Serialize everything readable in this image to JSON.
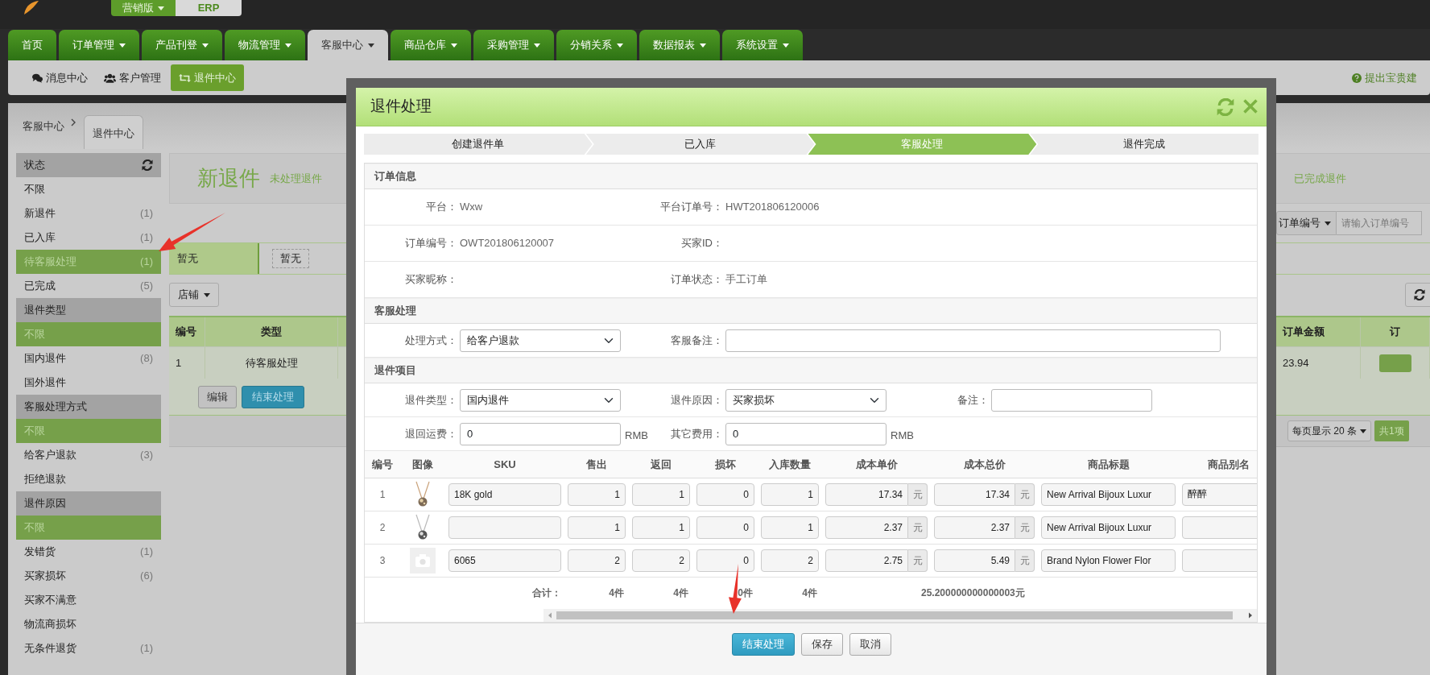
{
  "top_bar": {
    "edition_menu": "营销版",
    "product": "ERP"
  },
  "main_nav": [
    {
      "label": "首页",
      "dropdown": false,
      "selected": false
    },
    {
      "label": "订单管理",
      "dropdown": true,
      "selected": false
    },
    {
      "label": "产品刊登",
      "dropdown": true,
      "selected": false
    },
    {
      "label": "物流管理",
      "dropdown": true,
      "selected": false
    },
    {
      "label": "客服中心",
      "dropdown": true,
      "selected": true
    },
    {
      "label": "商品仓库",
      "dropdown": true,
      "selected": false
    },
    {
      "label": "采购管理",
      "dropdown": true,
      "selected": false
    },
    {
      "label": "分销关系",
      "dropdown": true,
      "selected": false
    },
    {
      "label": "数据报表",
      "dropdown": true,
      "selected": false
    },
    {
      "label": "系统设置",
      "dropdown": true,
      "selected": false
    }
  ],
  "sub_nav": [
    {
      "label": "消息中心",
      "kind": "messages",
      "selected": false
    },
    {
      "label": "客户管理",
      "kind": "customers",
      "selected": false
    },
    {
      "label": "退件中心",
      "kind": "returns",
      "selected": true
    }
  ],
  "help_link": "提出宝贵建",
  "breadcrumb": {
    "root": "客服中心",
    "tab": "退件中心"
  },
  "sidebar": [
    {
      "title": "状态",
      "refresh": true,
      "items": [
        {
          "label": "不限",
          "selected": false
        },
        {
          "label": "新退件",
          "count": "(1)",
          "selected": false
        },
        {
          "label": "已入库",
          "count": "(1)",
          "selected": false
        },
        {
          "label": "待客服处理",
          "count": "(1)",
          "selected": true
        },
        {
          "label": "已完成",
          "count": "(5)",
          "selected": false
        }
      ]
    },
    {
      "title": "退件类型",
      "refresh": false,
      "items": [
        {
          "label": "不限",
          "selected": true
        },
        {
          "label": "国内退件",
          "count": "(8)",
          "selected": false
        },
        {
          "label": "国外退件",
          "selected": false
        }
      ]
    },
    {
      "title": "客服处理方式",
      "refresh": false,
      "items": [
        {
          "label": "不限",
          "selected": true
        },
        {
          "label": "给客户退款",
          "count": "(3)",
          "selected": false
        },
        {
          "label": "拒绝退款",
          "selected": false
        }
      ]
    },
    {
      "title": "退件原因",
      "refresh": false,
      "items": [
        {
          "label": "不限",
          "selected": true
        },
        {
          "label": "发错货",
          "count": "(1)",
          "selected": false
        },
        {
          "label": "买家损坏",
          "count": "(6)",
          "selected": false
        },
        {
          "label": "买家不满意",
          "selected": false
        },
        {
          "label": "物流商损坏",
          "selected": false
        },
        {
          "label": "无条件退货",
          "count": "(1)",
          "selected": false
        }
      ]
    }
  ],
  "summary": {
    "title": "新退件",
    "subtitle": "未处理退件",
    "right_label": "已完成退件"
  },
  "search": {
    "field": "订单编号",
    "placeholder": "请输入订单编号"
  },
  "filter_tabs": [
    {
      "label": "暂无",
      "selected": true
    },
    {
      "label": "暂无",
      "selected": false
    }
  ],
  "shop_button": "店铺",
  "list_table": {
    "columns_left": [
      "编号",
      "类型"
    ],
    "columns_right": [
      "订单金额",
      "订"
    ],
    "rows": [
      {
        "no": "1",
        "type": "待客服处理",
        "amount": "23.94"
      }
    ],
    "actions": [
      {
        "label": "编辑",
        "kind": "default"
      },
      {
        "label": "结束处理",
        "kind": "primary"
      }
    ]
  },
  "pagination": {
    "page_size": "每页显示 20 条",
    "total": "共1项"
  },
  "modal": {
    "title": "退件处理",
    "steps": [
      {
        "label": "创建退件单",
        "selected": false
      },
      {
        "label": "已入库",
        "selected": false
      },
      {
        "label": "客服处理",
        "selected": true
      },
      {
        "label": "退件完成",
        "selected": false
      }
    ],
    "sections": [
      {
        "title": "订单信息",
        "kind": "info",
        "rows": [
          [
            {
              "label": "平台：",
              "value": "Wxw"
            },
            {
              "label": "平台订单号：",
              "value": "HWT201806120006"
            }
          ],
          [
            {
              "label": "订单编号：",
              "value": "OWT201806120007"
            },
            {
              "label": "买家ID："
            }
          ],
          [
            {
              "label": "买家昵称："
            },
            {
              "label": "订单状态：",
              "value": "手工订单"
            }
          ]
        ]
      },
      {
        "title": "客服处理",
        "kind": "form",
        "rows": [
          [
            {
              "kind": "select",
              "label": "处理方式：",
              "value": "给客户退款"
            },
            {
              "kind": "input",
              "label": "客服备注："
            }
          ]
        ]
      },
      {
        "title": "退件项目",
        "kind": "form",
        "rows": [
          [
            {
              "kind": "select",
              "label": "退件类型：",
              "value": "国内退件"
            },
            {
              "kind": "select",
              "label": "退件原因：",
              "value": "买家损坏"
            },
            {
              "kind": "input",
              "label": "备注："
            }
          ],
          [
            {
              "kind": "input",
              "label": "退回运费：",
              "value": "0",
              "unit": "RMB"
            },
            {
              "kind": "input",
              "label": "其它费用：",
              "value": "0",
              "unit": "RMB"
            }
          ]
        ]
      }
    ],
    "items_table": {
      "columns": [
        "编号",
        "图像",
        "SKU",
        "售出",
        "返回",
        "损坏",
        "入库数量",
        "成本单价",
        "成本总价",
        "商品标题",
        "商品别名"
      ],
      "rows": [
        {
          "no": "1",
          "sku": "18K gold",
          "sold": "1",
          "returned": "1",
          "damaged": "0",
          "stocked": "1",
          "unit_cost": "17.34",
          "unit_cost_currency": "元",
          "total_cost": "17.34",
          "total_cost_currency": "元",
          "title": "New Arrival Bijoux Luxur",
          "alias": "醉醉"
        },
        {
          "no": "2",
          "sold": "1",
          "returned": "1",
          "damaged": "0",
          "stocked": "1",
          "unit_cost": "2.37",
          "unit_cost_currency": "元",
          "total_cost": "2.37",
          "total_cost_currency": "元",
          "title": "New Arrival Bijoux Luxur"
        },
        {
          "no": "3",
          "image": {
            "kind": "placeholder"
          },
          "sku": "6065",
          "sold": "2",
          "returned": "2",
          "damaged": "0",
          "stocked": "2",
          "unit_cost": "2.75",
          "unit_cost_currency": "元",
          "total_cost": "5.49",
          "total_cost_currency": "元",
          "title": "Brand Nylon Flower Flor"
        }
      ],
      "totals": {
        "label": "合计：",
        "sold": "4件",
        "returned": "4件",
        "damaged": "0件",
        "stocked": "4件",
        "total_cost": "25.200000000000003元"
      }
    },
    "buttons": [
      {
        "label": "结束处理",
        "kind": "primary"
      },
      {
        "label": "保存",
        "kind": "default"
      },
      {
        "label": "取消",
        "kind": "default"
      }
    ]
  }
}
